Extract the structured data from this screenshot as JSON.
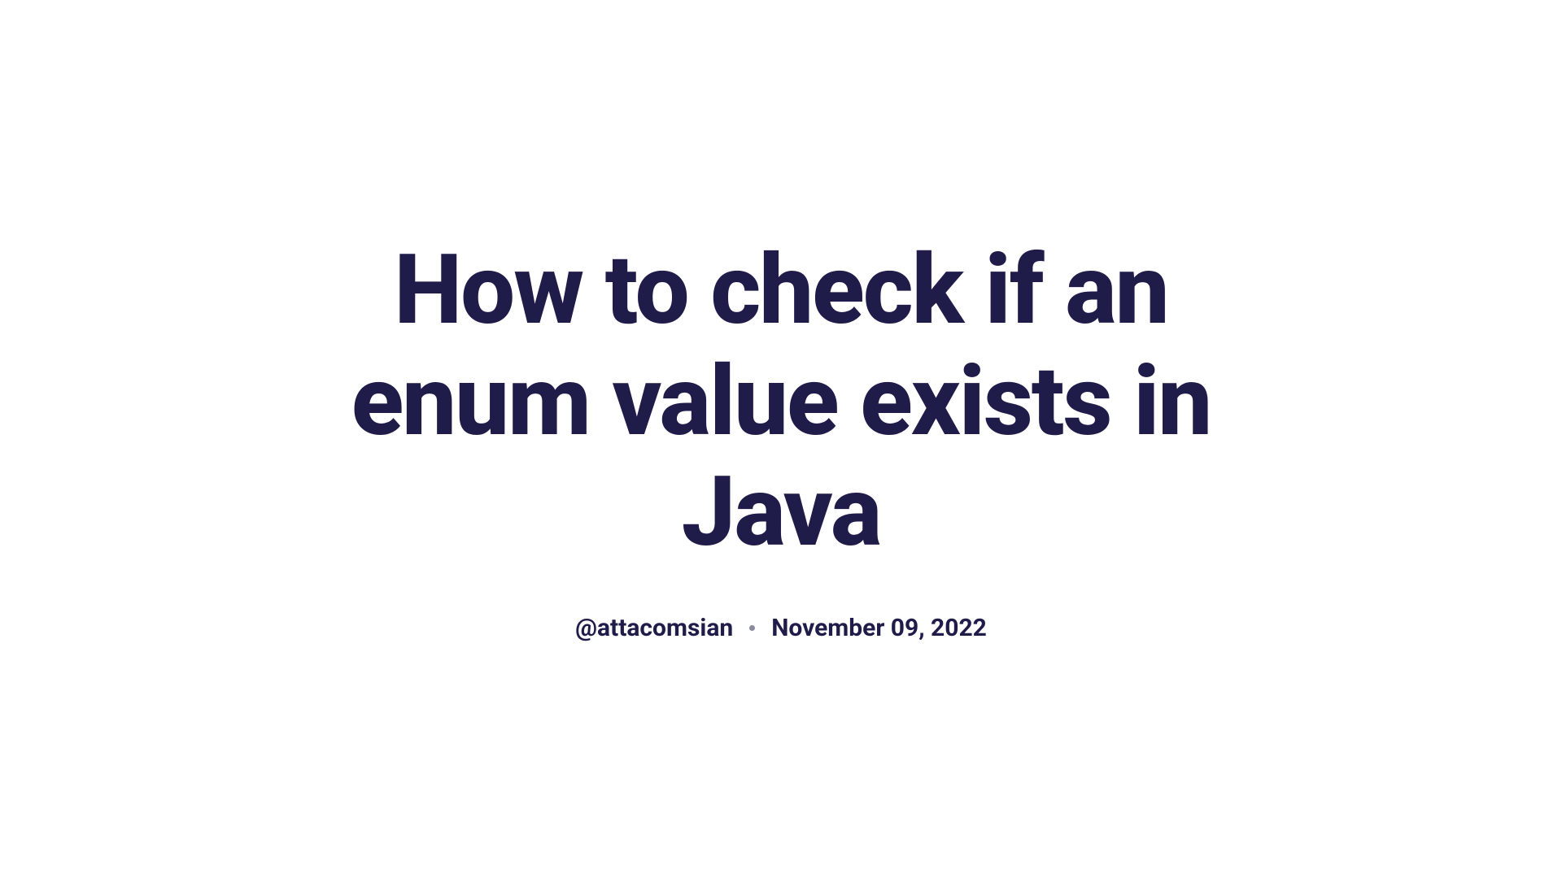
{
  "article": {
    "title": "How to check if an enum value exists in Java",
    "author": "@attacomsian",
    "date": "November 09, 2022"
  }
}
